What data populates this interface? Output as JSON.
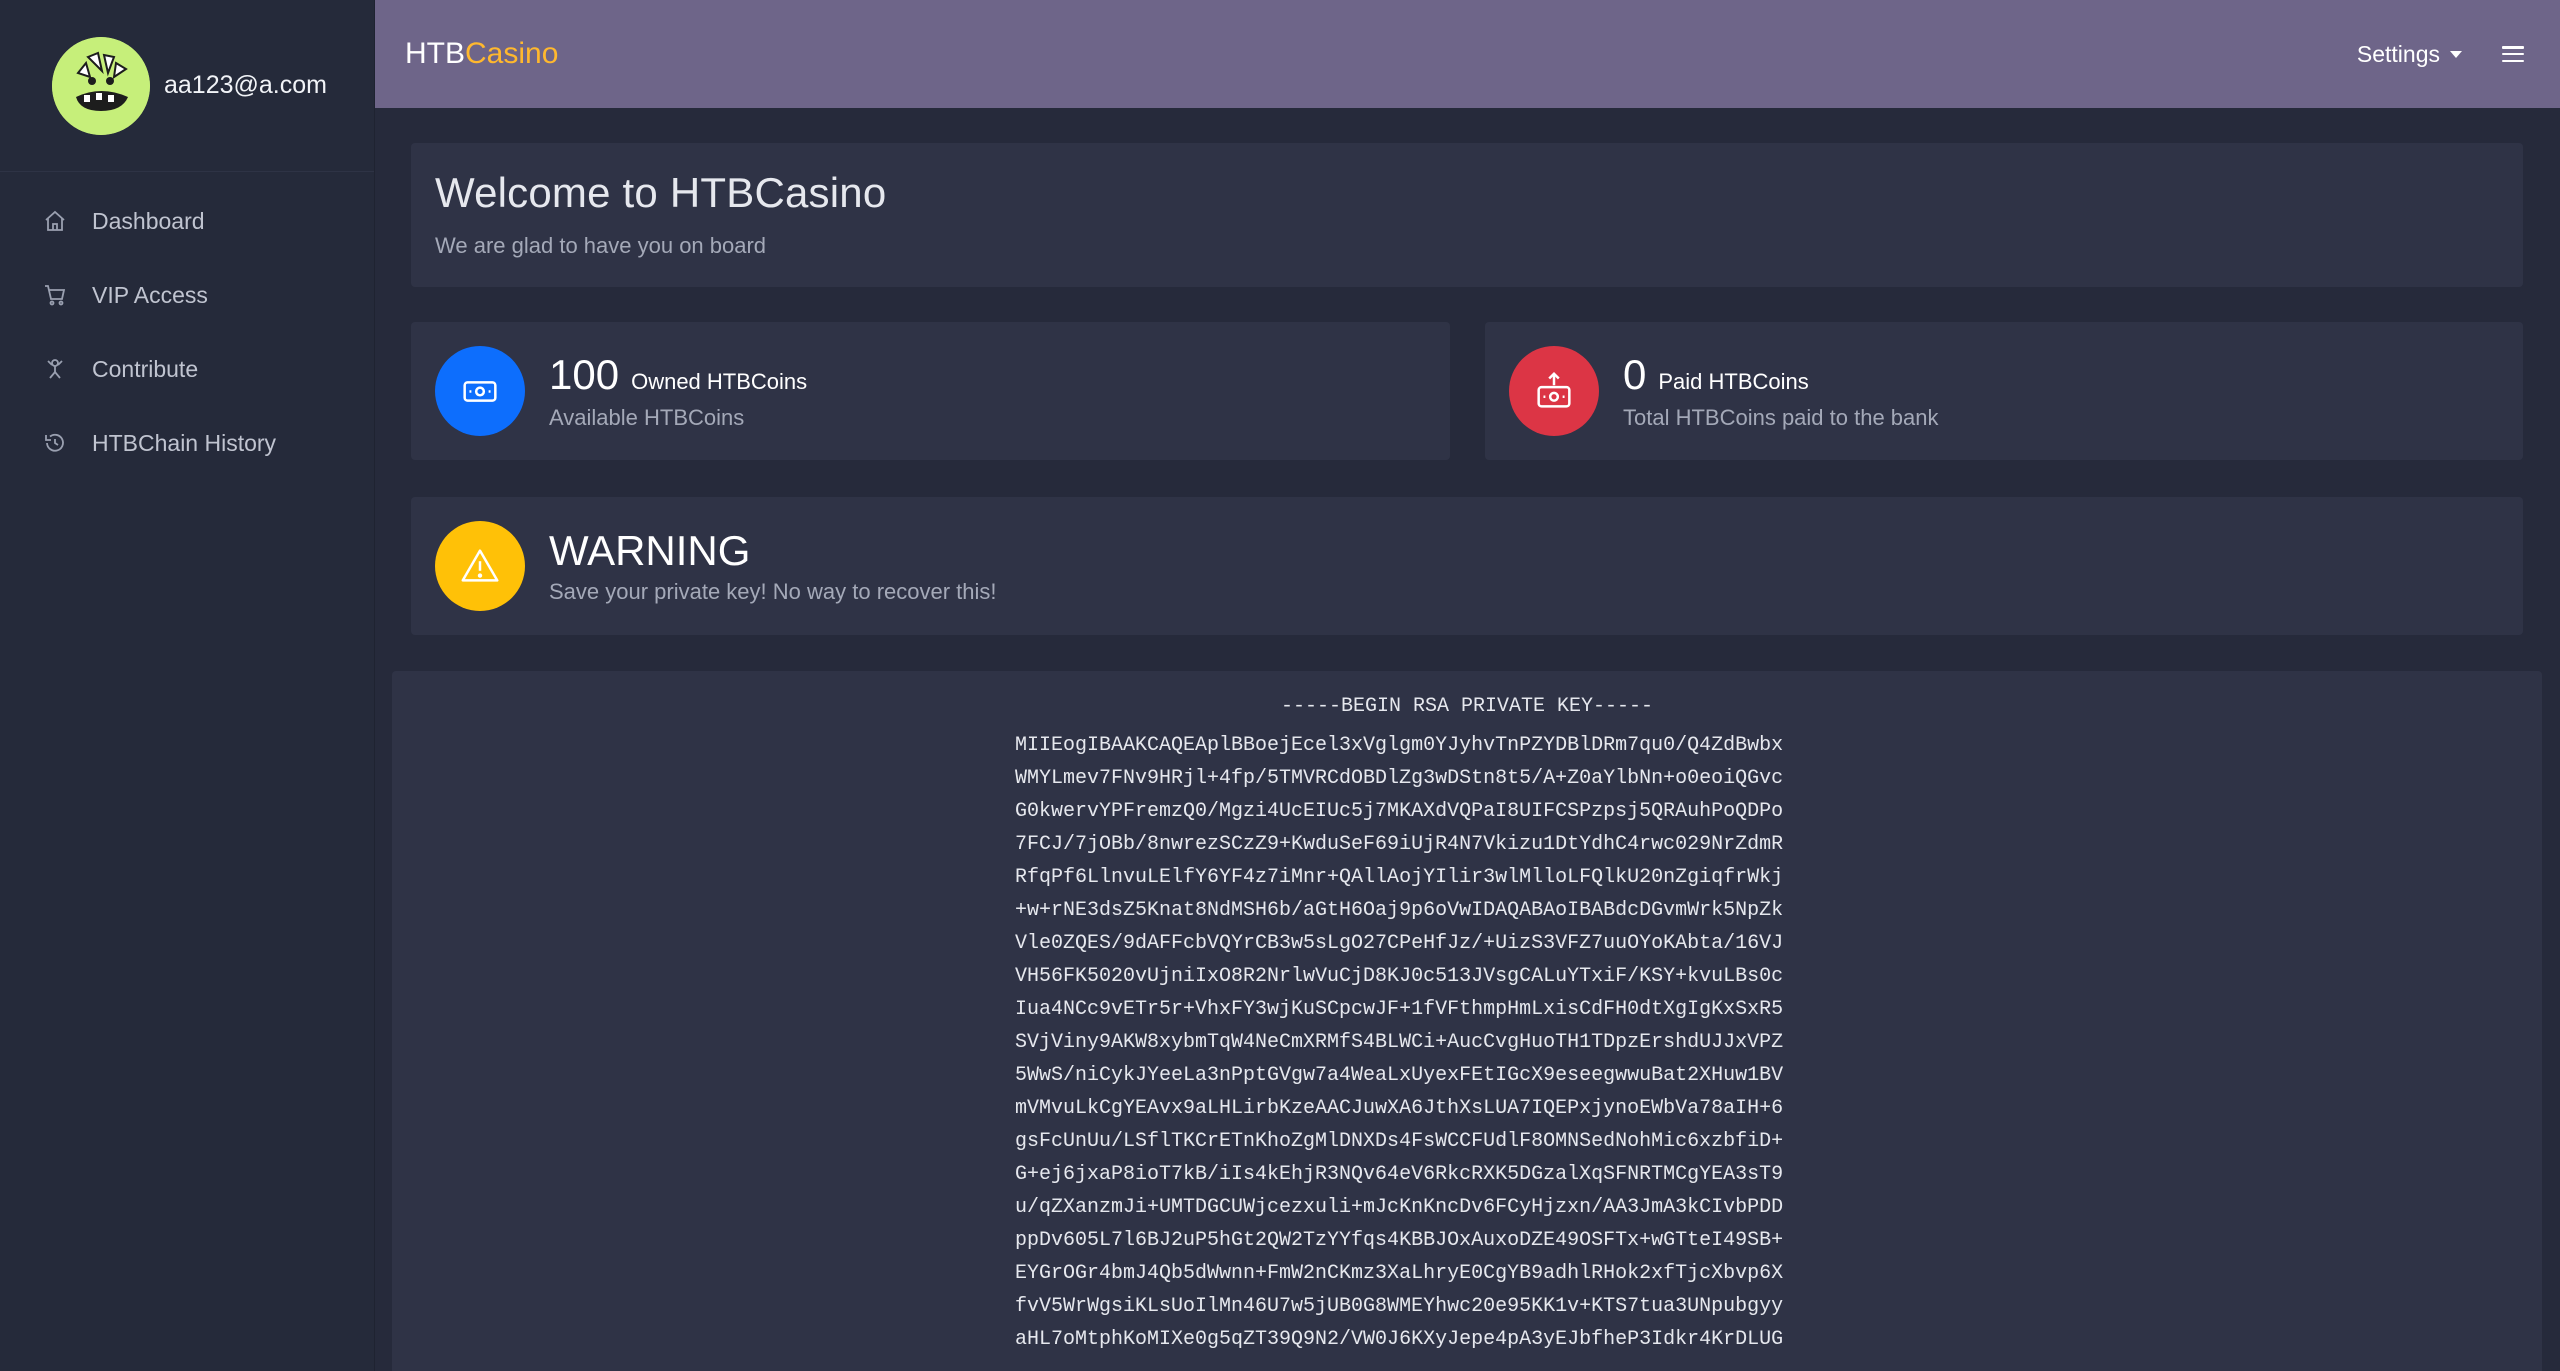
{
  "user": {
    "email": "aa123@a.com"
  },
  "sidebar": {
    "items": [
      {
        "label": "Dashboard",
        "icon": "home-icon"
      },
      {
        "label": "VIP Access",
        "icon": "cart-icon"
      },
      {
        "label": "Contribute",
        "icon": "contribute-icon"
      },
      {
        "label": "HTBChain History",
        "icon": "history-icon"
      }
    ]
  },
  "header": {
    "brand_part1": "HTB",
    "brand_part2": "Casino",
    "settings_label": "Settings",
    "brand_accent_color": "#ffb82e",
    "bar_color": "#6e6589"
  },
  "welcome": {
    "title": "Welcome to HTBCasino",
    "subtitle": "We are glad to have you on board"
  },
  "stats": {
    "owned": {
      "value": "100",
      "label": "Owned HTBCoins",
      "sub": "Available HTBCoins",
      "color": "#0d6efd"
    },
    "paid": {
      "value": "0",
      "label": "Paid HTBCoins",
      "sub": "Total HTBCoins paid to the bank",
      "color": "#dc3545"
    }
  },
  "warning": {
    "title": "WARNING",
    "text": "Save your private key! No way to recover this!",
    "color": "#ffc107"
  },
  "private_key": {
    "header": "-----BEGIN RSA PRIVATE KEY-----",
    "lines": [
      "MIIEogIBAAKCAQEAplBBoejEcel3xVglgm0YJyhvTnPZYDBlDRm7qu0/Q4ZdBwbx",
      "WMYLmev7FNv9HRjl+4fp/5TMVRCdOBDlZg3wDStn8t5/A+Z0aYlbNn+o0eoiQGvc",
      "G0kwervYPFremzQ0/Mgzi4UcEIUc5j7MKAXdVQPaI8UIFCSPzpsj5QRAuhPoQDPo",
      "7FCJ/7jOBb/8nwrezSCzZ9+KwduSeF69iUjR4N7Vkizu1DtYdhC4rwc029NrZdmR",
      "RfqPf6LlnvuLElfY6YF4z7iMnr+QAllAojYIlir3wlMlloLFQlkU20nZgiqfrWkj",
      "+w+rNE3dsZ5Knat8NdMSH6b/aGtH6Oaj9p6oVwIDAQABAoIBABdcDGvmWrk5NpZk",
      "Vle0ZQES/9dAFFcbVQYrCB3w5sLgO27CPeHfJz/+UizS3VFZ7uuOYoKAbta/16VJ",
      "VH56FK5020vUjniIxO8R2NrlwVuCjD8KJ0c513JVsgCALuYTxiF/KSY+kvuLBs0c",
      "Iua4NCc9vETr5r+VhxFY3wjKuSCpcwJF+1fVFthmpHmLxisCdFH0dtXgIgKxSxR5",
      "SVjViny9AKW8xybmTqW4NeCmXRMfS4BLWCi+AucCvgHuoTH1TDpzErshdUJJxVPZ",
      "5WwS/niCykJYeeLa3nPptGVgw7a4WeaLxUyexFEtIGcX9eseegwwuBat2XHuw1BV",
      "mVMvuLkCgYEAvx9aLHLirbKzeAACJuwXA6JthXsLUA7IQEPxjynoEWbVa78aIH+6",
      "gsFcUnUu/LSflTKCrETnKhoZgMlDNXDs4FsWCCFUdlF8OMNSedNohMic6xzbfiD+",
      "G+ej6jxaP8ioT7kB/iIs4kEhjR3NQv64eV6RkcRXK5DGzalXqSFNRTMCgYEA3sT9",
      "u/qZXanzmJi+UMTDGCUWjcezxuli+mJcKnKncDv6FCyHjzxn/AA3JmA3kCIvbPDD",
      "ppDv605L7l6BJ2uP5hGt2QW2TzYYfqs4KBBJOxAuxoDZE49OSFTx+wGTteI49SB+",
      "EYGrOGr4bmJ4Qb5dWwnn+FmW2nCKmz3XaLhryE0CgYB9adhlRHok2xfTjcXbvp6X",
      "fvV5WrWgsiKLsUoIlMn46U7w5jUB0G8WMEYhwc20e95KK1v+KTS7tua3UNpubgyy",
      "aHL7oMtphKoMIXe0g5qZT39Q9N2/VW0J6KXyJepe4pA3yEJbfheP3Idkr4KrDLUG"
    ]
  }
}
